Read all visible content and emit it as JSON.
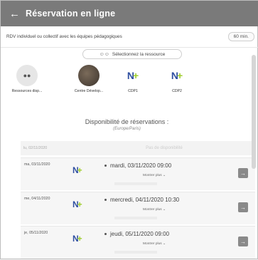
{
  "header": {
    "back_icon": "arrow-left-icon",
    "title": "Réservation en ligne"
  },
  "subbar": {
    "description": "RDV individuel ou collectif avec les équipes pédagogiques",
    "duration": "60 min."
  },
  "resource_selector": {
    "icon": "users-icon",
    "label": "Sélectionnez la ressource"
  },
  "resources": [
    {
      "label": "Ressources disp...",
      "icon": "users-icon"
    },
    {
      "label": "Centre Dévelop...",
      "icon": "photo-avatar"
    },
    {
      "label": "CDP1",
      "icon": "n-plus-logo"
    },
    {
      "label": "CDP2",
      "icon": "n-plus-logo"
    }
  ],
  "logo": {
    "n": "N",
    "plus": "+"
  },
  "availability": {
    "heading": "Disponibilité de réservations :",
    "timezone": "(Europe/Paris)",
    "rows": [
      {
        "day": "lu, 02/11/2020",
        "message": "Pas de disponibilité"
      },
      {
        "day": "ma, 03/11/2020",
        "slot": "mardi, 03/11/2020 09:00",
        "more": "Montrer plus"
      },
      {
        "day": "me, 04/11/2020",
        "slot": "mercredi, 04/11/2020 10:30",
        "more": "Montrer plus"
      },
      {
        "day": "je, 05/11/2020",
        "slot": "jeudi, 05/11/2020 09:00",
        "more": "Montrer plus"
      }
    ]
  },
  "colors": {
    "header": "#7a7a7a",
    "logo_blue": "#2f4fa1",
    "logo_green": "#9fcd2c"
  }
}
